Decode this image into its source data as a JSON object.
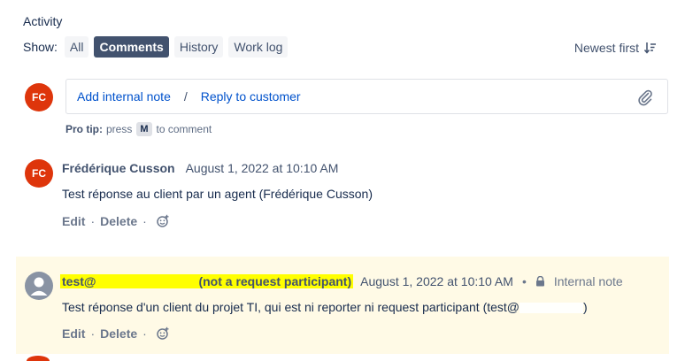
{
  "activity": {
    "title": "Activity"
  },
  "filters": {
    "show_label": "Show:",
    "items": [
      {
        "label": "All",
        "active": false
      },
      {
        "label": "Comments",
        "active": true
      },
      {
        "label": "History",
        "active": false
      },
      {
        "label": "Work log",
        "active": false
      }
    ],
    "sort_label": "Newest first"
  },
  "composer": {
    "avatar_initials": "FC",
    "internal_note": "Add internal note",
    "separator": "/",
    "reply": "Reply to customer",
    "pro_tip_bold": "Pro tip:",
    "pro_tip_press": "press",
    "pro_tip_key": "M",
    "pro_tip_suffix": "to comment"
  },
  "comments": [
    {
      "avatar_initials": "FC",
      "author": "Frédérique Cusson",
      "timestamp": "August 1, 2022 at 10:10 AM",
      "body": "Test réponse au client par un agent (Frédérique Cusson)",
      "actions": {
        "edit": "Edit",
        "delete": "Delete"
      }
    },
    {
      "author_prefix": "test@",
      "author_suffix": "(not a request participant)",
      "timestamp": "August 1, 2022 at 10:10 AM",
      "visibility": "Internal note",
      "body_prefix": "Test réponse d'un client du projet TI, qui est ni reporter ni request participant (test@",
      "body_suffix": ")",
      "actions": {
        "edit": "Edit",
        "delete": "Delete"
      },
      "background": "#fffae6",
      "highlight_color": "#ffff00"
    }
  ],
  "colors": {
    "brand_link": "#0052cc",
    "avatar_fc": "#de350b",
    "active_filter": "#42526e"
  }
}
